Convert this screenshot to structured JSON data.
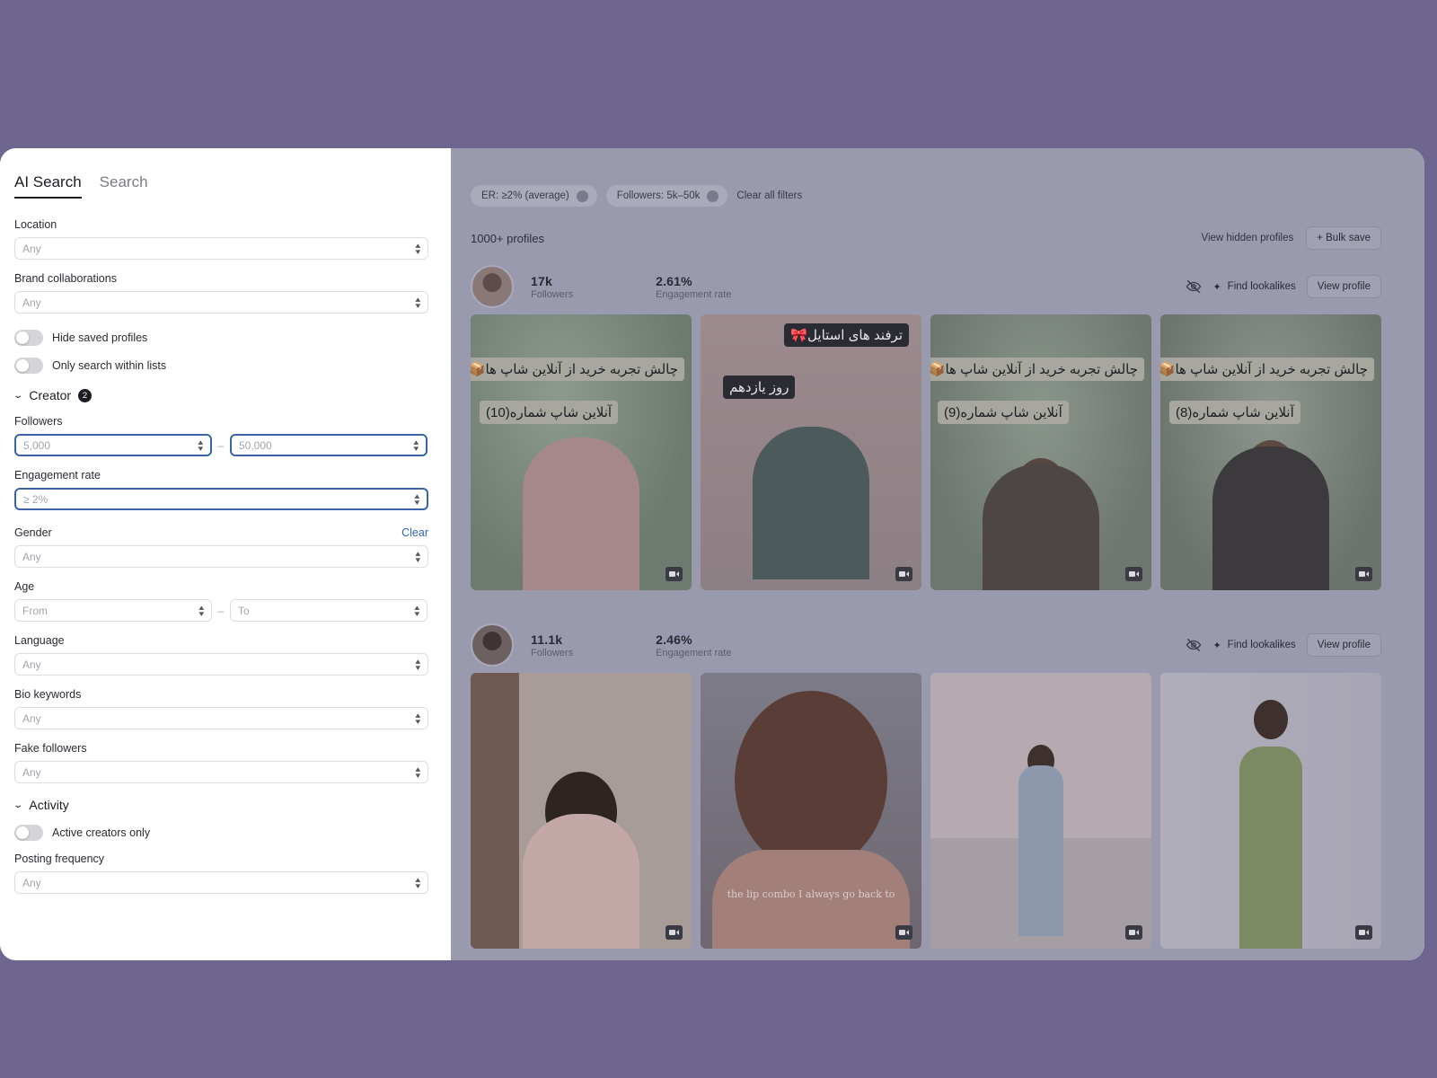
{
  "sidebar": {
    "tabs": [
      {
        "label": "AI Search",
        "active": true
      },
      {
        "label": "Search",
        "active": false
      }
    ],
    "location": {
      "label": "Location",
      "value": "Any"
    },
    "brand_collaborations": {
      "label": "Brand collaborations",
      "value": "Any"
    },
    "toggles": {
      "hide_saved": "Hide saved profiles",
      "only_lists": "Only search within lists"
    },
    "creator_section": {
      "label": "Creator",
      "badge": "2"
    },
    "followers": {
      "label": "Followers",
      "from": "5,000",
      "to": "50,000",
      "dash": "–"
    },
    "engagement_rate": {
      "label": "Engagement rate",
      "value": "≥ 2%"
    },
    "gender": {
      "label": "Gender",
      "clear": "Clear",
      "value": "Any"
    },
    "age": {
      "label": "Age",
      "from": "From",
      "to": "To",
      "dash": "–"
    },
    "language": {
      "label": "Language",
      "value": "Any"
    },
    "bio_keywords": {
      "label": "Bio keywords",
      "value": "Any"
    },
    "fake_followers": {
      "label": "Fake followers",
      "value": "Any"
    },
    "activity_section": {
      "label": "Activity"
    },
    "active_creators": "Active creators only",
    "posting_frequency": {
      "label": "Posting frequency",
      "value": "Any"
    }
  },
  "main": {
    "chips": [
      {
        "label": "ER: ≥2% (average)"
      },
      {
        "label": "Followers: 5k–50k"
      }
    ],
    "clear_all": "Clear all filters",
    "count": "1000+ profiles",
    "view_hidden": "View hidden profiles",
    "bulk_save": "+ Bulk save",
    "profiles": [
      {
        "followers_value": "17k",
        "followers_label": "Followers",
        "er_value": "2.61%",
        "er_label": "Engagement rate",
        "find_lookalikes": "Find lookalikes",
        "view_profile": "View profile",
        "posts": [
          {
            "tag_top": "چالش تجربه خرید از آنلاین شاپ ها📦🛍️",
            "tag_mid": "آنلاین شاپ شماره(10)"
          },
          {
            "tag_top": "ترفند های استایل🎀",
            "tag_mid": "روز یازدهم"
          },
          {
            "tag_top": "چالش تجربه خرید از آنلاین شاپ ها📦🛍️",
            "tag_mid": "آنلاین شاپ شماره(9)"
          },
          {
            "tag_top": "چالش تجربه خرید از آنلاین شاپ ها📦🛍️",
            "tag_mid": "آنلاین شاپ شماره(8)"
          }
        ]
      },
      {
        "followers_value": "11.1k",
        "followers_label": "Followers",
        "er_value": "2.46%",
        "er_label": "Engagement rate",
        "find_lookalikes": "Find lookalikes",
        "view_profile": "View profile",
        "posts": [
          {
            "caption": ""
          },
          {
            "caption": "the lip combo I always go back to"
          },
          {
            "caption": ""
          },
          {
            "caption": ""
          }
        ]
      }
    ]
  },
  "colors": {
    "page_bg": "#6e668f",
    "overlay_bg": "#9a9aaf",
    "accent_blue": "#3a62a8"
  }
}
